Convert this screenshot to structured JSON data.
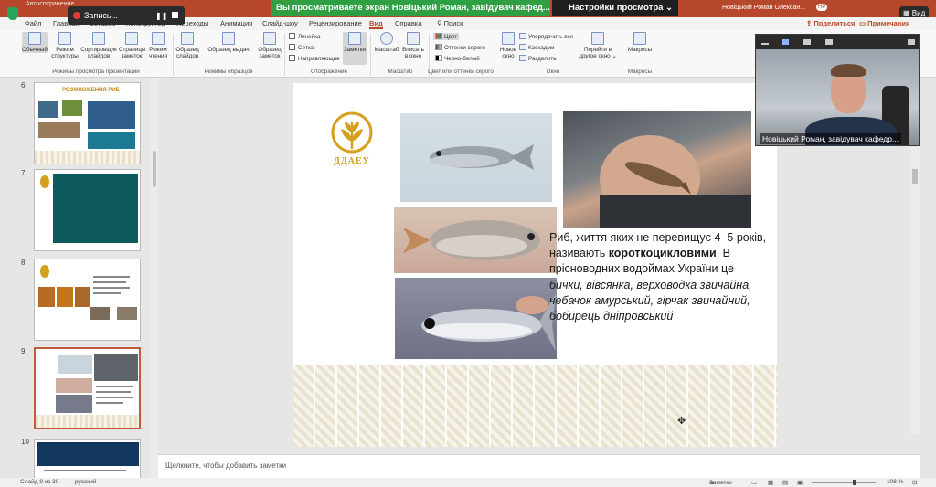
{
  "titlebar": {
    "autosave": "Автосохранение",
    "user": "Новіцький Роман Олексан...",
    "initials": "НР"
  },
  "zoom": {
    "recording_label": "Запись...",
    "share_banner": "Вы просматриваете экран Новіцький Роман, завідувач кафед...",
    "view_options": "Настройки просмотра",
    "view_button": "Вид"
  },
  "menu": {
    "tabs": [
      "Файл",
      "Главная",
      "Вставка",
      "Конструктор",
      "Переходы",
      "Анимация",
      "Слайд-шоу",
      "Рецензирование",
      "Вид",
      "Справка"
    ],
    "search": "Поиск",
    "share": "Поделиться",
    "comments": "Примечания"
  },
  "ribbon": {
    "groups": [
      {
        "label": "Режимы просмотра презентации",
        "buttons": [
          "Обычный",
          "Режим структуры",
          "Сортировщик слайдов",
          "Страницы заметок",
          "Режим чтения"
        ]
      },
      {
        "label": "Режимы образцов",
        "buttons": [
          "Образец слайдов",
          "Образец выдач",
          "Образец заметок"
        ]
      },
      {
        "label": "Отображение",
        "checks": [
          "Линейка",
          "Сетка",
          "Направляющие"
        ],
        "buttons": [
          "Заметки"
        ]
      },
      {
        "label": "Масштаб",
        "buttons": [
          "Масштаб",
          "Вписать в окно"
        ]
      },
      {
        "label": "Цвет или оттенки серого",
        "options": [
          "Цвет",
          "Оттенки серого",
          "Черно-белый"
        ]
      },
      {
        "label": "Окно",
        "buttons": [
          "Новое окно"
        ],
        "options": [
          "Упорядочить все",
          "Каскадом",
          "Разделить"
        ]
      },
      {
        "label": "",
        "buttons": [
          "Перейти в другое окно"
        ]
      },
      {
        "label": "Макросы",
        "buttons": [
          "Макросы"
        ]
      }
    ]
  },
  "thumbnails": {
    "items": [
      {
        "num": "6",
        "title": "РОЗМНОЖЕННЯ РИБ"
      },
      {
        "num": "7",
        "title": ""
      },
      {
        "num": "8",
        "title": ""
      },
      {
        "num": "9",
        "title": ""
      },
      {
        "num": "10",
        "title": ""
      }
    ]
  },
  "slide": {
    "logo_text": "ДДАЕУ",
    "paragraph": [
      {
        "t": "Риб, життя яких не перевищує 4–5 років, називають ",
        "s": ""
      },
      {
        "t": "короткоцикловими",
        "s": "b"
      },
      {
        "t": ". В прісноводних водоймах України це ",
        "s": ""
      },
      {
        "t": "бички, вівсянка, верховодка звичайна, чебачок амурський, гірчак звичайний,  бобирець дніпровський",
        "s": "i"
      }
    ]
  },
  "notes": {
    "placeholder": "Щелкните, чтобы добавить заметки"
  },
  "status": {
    "slide": "Слайд 9 из 30",
    "language": "русский",
    "notes": "Заметки",
    "zoom": "108 %"
  },
  "video": {
    "name": "Новіцький Роман, завідувач кафедр..."
  }
}
